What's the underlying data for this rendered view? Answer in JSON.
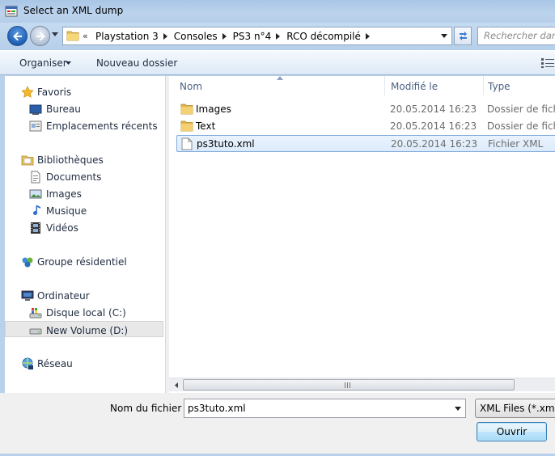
{
  "window": {
    "title": "Select an XML dump"
  },
  "address": {
    "overflow": "«",
    "crumbs": [
      {
        "label": "Playstation 3"
      },
      {
        "label": "Consoles"
      },
      {
        "label": "PS3 n°4"
      },
      {
        "label": "RCO décompilé"
      }
    ]
  },
  "search": {
    "placeholder": "Rechercher dans : RCO décompilé"
  },
  "toolbar": {
    "organize_label": "Organiser",
    "new_folder_label": "Nouveau dossier"
  },
  "navigation": {
    "favorites": {
      "label": "Favoris",
      "items": [
        {
          "label": "Bureau"
        },
        {
          "label": "Emplacements récents"
        }
      ]
    },
    "libraries": {
      "label": "Bibliothèques",
      "items": [
        {
          "label": "Documents"
        },
        {
          "label": "Images"
        },
        {
          "label": "Musique"
        },
        {
          "label": "Vidéos"
        }
      ]
    },
    "homegroup": {
      "label": "Groupe résidentiel"
    },
    "computer": {
      "label": "Ordinateur",
      "items": [
        {
          "label": "Disque local (C:)"
        },
        {
          "label": "New Volume (D:)"
        }
      ]
    },
    "network": {
      "label": "Réseau"
    },
    "selected": "New Volume (D:)"
  },
  "file_list": {
    "columns": {
      "name": "Nom",
      "modified": "Modifié le",
      "type": "Type"
    },
    "rows": [
      {
        "name": "Images",
        "modified": "20.05.2014 16:23",
        "type": "Dossier de fichiers",
        "icon": "folder-icon"
      },
      {
        "name": "Text",
        "modified": "20.05.2014 16:23",
        "type": "Dossier de fichiers",
        "icon": "folder-icon"
      },
      {
        "name": "ps3tuto.xml",
        "modified": "20.05.2014 16:23",
        "type": "Fichier XML",
        "icon": "xml-file-icon"
      }
    ],
    "selected": "ps3tuto.xml"
  },
  "footer": {
    "filename_label": "Nom du fichier :",
    "filename_value": "ps3tuto.xml",
    "filter_value": "XML Files (*.xml)",
    "open_label": "Ouvrir"
  },
  "colors": {
    "frame": "#b9d1ea",
    "selection_border": "#84acdd",
    "link_text": "#1e2b40"
  }
}
